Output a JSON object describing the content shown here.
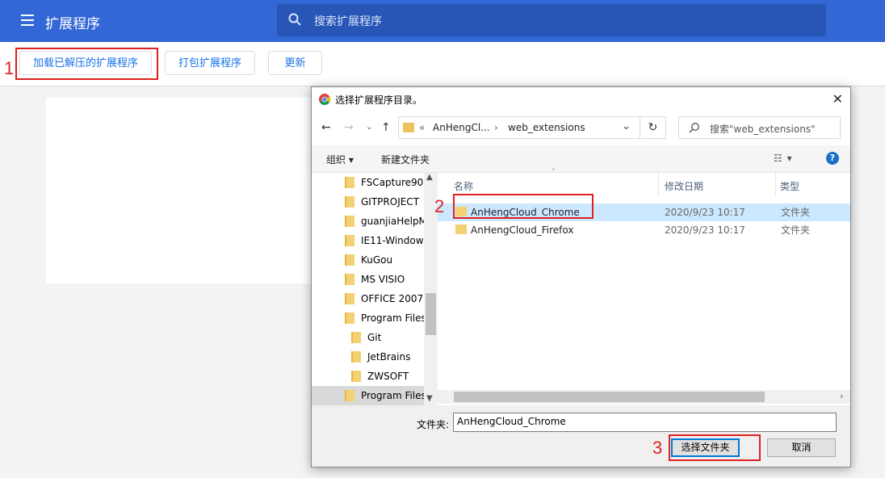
{
  "chrome_page": {
    "title": "扩展程序",
    "search_placeholder": "搜索扩展程序",
    "toolbar": {
      "load_unpacked": "加载已解压的扩展程序",
      "pack_extension": "打包扩展程序",
      "update": "更新"
    }
  },
  "annotations": {
    "step1": "1",
    "step2": "2",
    "step3": "3"
  },
  "dialog": {
    "title": "选择扩展程序目录。",
    "close": "✕",
    "address": {
      "prefix": "«",
      "crumb1": "AnHengCl...",
      "sep": "›",
      "crumb2": "web_extensions"
    },
    "search_placeholder": "搜索\"web_extensions\"",
    "commands": {
      "organize": "组织 ▾",
      "new_folder": "新建文件夹",
      "help": "?"
    },
    "tree": [
      {
        "label": "FSCapture90",
        "selected": false,
        "indent": 1
      },
      {
        "label": "GITPROJECT",
        "selected": false,
        "indent": 1
      },
      {
        "label": "guanjiaHelpM",
        "selected": false,
        "indent": 1
      },
      {
        "label": "IE11-Window",
        "selected": false,
        "indent": 1
      },
      {
        "label": "KuGou",
        "selected": false,
        "indent": 1
      },
      {
        "label": "MS VISIO",
        "selected": false,
        "indent": 1
      },
      {
        "label": "OFFICE 2007",
        "selected": false,
        "indent": 1
      },
      {
        "label": "Program Files",
        "selected": false,
        "indent": 1
      },
      {
        "label": "Git",
        "selected": false,
        "indent": 2
      },
      {
        "label": "JetBrains",
        "selected": false,
        "indent": 2
      },
      {
        "label": "ZWSOFT",
        "selected": false,
        "indent": 2
      },
      {
        "label": "Program Files",
        "selected": true,
        "indent": 1
      }
    ],
    "columns": {
      "name": "名称",
      "modified": "修改日期",
      "type": "类型"
    },
    "files": [
      {
        "name": "AnHengCloud_Chrome",
        "modified": "2020/9/23 10:17",
        "type": "文件夹",
        "selected": true
      },
      {
        "name": "AnHengCloud_Firefox",
        "modified": "2020/9/23 10:17",
        "type": "文件夹",
        "selected": false
      }
    ],
    "folder_label": "文件夹:",
    "folder_value": "AnHengCloud_Chrome",
    "select_button": "选择文件夹",
    "cancel_button": "取消"
  }
}
